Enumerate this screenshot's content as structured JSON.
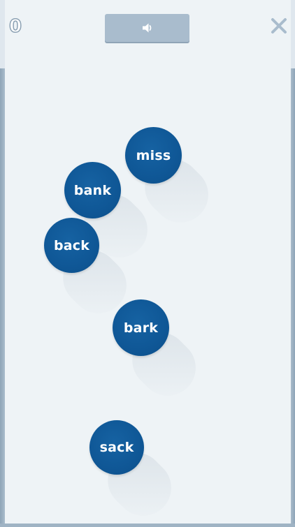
{
  "header": {
    "score": "0",
    "sound_button_icon": "speaker-icon",
    "close_icon": "close-icon"
  },
  "bubbles": [
    {
      "word": "miss"
    },
    {
      "word": "bank"
    },
    {
      "word": "back"
    },
    {
      "word": "bark"
    },
    {
      "word": "sack"
    }
  ],
  "colors": {
    "bubble": "#0f5796",
    "background": "#eef3f6",
    "accent_gray": "#a9bccd"
  }
}
